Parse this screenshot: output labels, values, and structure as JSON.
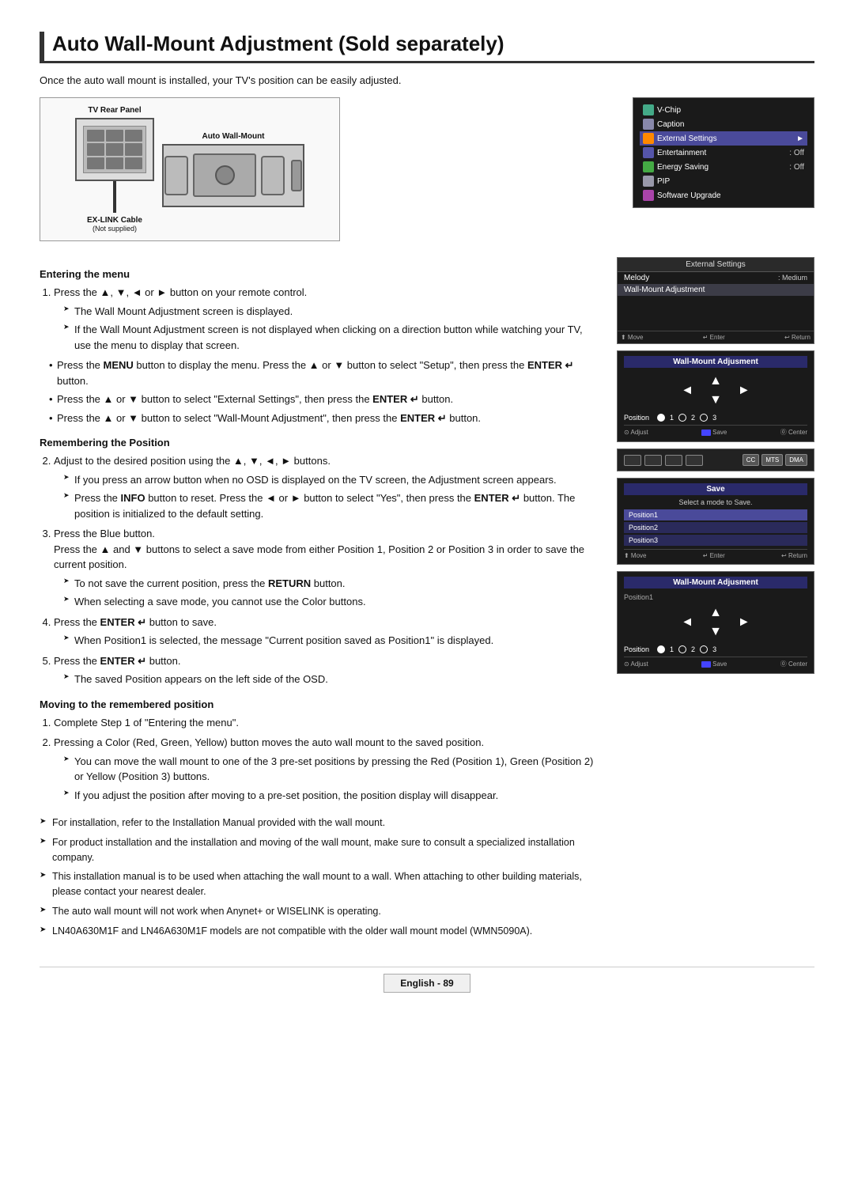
{
  "page": {
    "title": "Auto Wall-Mount Adjustment (Sold separately)",
    "intro": "Once the auto wall mount is installed, your TV's position can be easily adjusted."
  },
  "diagram": {
    "tv_label": "TV Rear Panel",
    "wm_label": "Auto Wall-Mount",
    "cable_label": "EX-LINK Cable",
    "cable_sublabel": "(Not supplied)"
  },
  "osd1": {
    "title": "External Settings",
    "items": [
      {
        "label": "V-Chip",
        "value": ""
      },
      {
        "label": "Caption",
        "value": ""
      },
      {
        "label": "External Settings",
        "value": "",
        "selected": true
      },
      {
        "label": "Entertainment",
        "value": ": Off"
      },
      {
        "label": "Energy Saving",
        "value": ": Off"
      },
      {
        "label": "PIP",
        "value": ""
      },
      {
        "label": "Software Upgrade",
        "value": ""
      }
    ]
  },
  "osd2": {
    "header": "External Settings",
    "melody_label": "Melody",
    "melody_value": ": Medium",
    "wma_label": "Wall-Mount Adjustment",
    "nav_move": "⬆ Move",
    "nav_enter": "↵ Enter",
    "nav_return": "↩ Return"
  },
  "osd3": {
    "title": "Wall-Mount Adjusment",
    "position_label": "Position",
    "pos1": "1",
    "pos2": "2",
    "pos3": "3",
    "adjust_label": "⊙ Adjust",
    "save_label": "Save",
    "center_label": "⓪ Center"
  },
  "osd4": {
    "save_title": "Save",
    "save_prompt": "Select a mode to Save.",
    "options": [
      "Position1",
      "Position2",
      "Position3"
    ],
    "nav_move": "⬆ Move",
    "nav_enter": "↵ Enter",
    "nav_return": "↩ Return"
  },
  "osd5": {
    "title": "Wall-Mount Adjusment",
    "position_label": "Position",
    "pos1_label": "Position1",
    "pos1": "1",
    "pos2": "2",
    "pos3": "3",
    "adjust_label": "⊙ Adjust",
    "save_label": "Save",
    "center_label": "⓪ Center"
  },
  "sections": {
    "entering_menu": {
      "heading": "Entering the menu",
      "step1": {
        "text": "Press the ▲, ▼, ◄ or ► button on your remote control.",
        "sub1": "The Wall Mount Adjustment screen is displayed.",
        "sub2": "If the Wall Mount Adjustment screen is not displayed when clicking on a direction button while watching your TV, use the menu to display that screen."
      },
      "bullet1": "Press the MENU button to display the menu. Press the ▲ or ▼ button to select \"Setup\", then press the ENTER ↵ button.",
      "bullet2": "Press the ▲ or ▼ button to select \"External Settings\", then press the ENTER ↵ button.",
      "bullet3": "Press the ▲ or ▼ button to select \"Wall-Mount Adjustment\", then press the ENTER ↵ button."
    },
    "remembering": {
      "heading": "Remembering the Position",
      "step2": {
        "text": "Adjust to the desired position using the ▲, ▼, ◄, ► buttons.",
        "sub1": "If you press an arrow button when no OSD is displayed on the TV screen, the Adjustment screen appears.",
        "sub2": "Press the INFO button to reset. Press the ◄ or ► button to select \"Yes\", then press the ENTER ↵ button. The position is initialized to the default setting."
      },
      "step3": {
        "text": "Press the Blue button.",
        "sub_text": "Press the ▲ and ▼ buttons to select a save mode from either Position 1, Position 2 or Position 3 in order to save the current position.",
        "sub1": "To not save the current position, press the RETURN button.",
        "sub2": "When selecting a save mode, you cannot use the Color buttons."
      },
      "step4": {
        "text": "Press the ENTER ↵ button to save.",
        "sub1": "When Position1 is selected, the message \"Current position saved as Position1\" is displayed."
      },
      "step5": {
        "text": "Press the ENTER ↵ button.",
        "sub1": "The saved Position appears on the left side of the OSD."
      }
    },
    "moving": {
      "heading": "Moving to the remembered position",
      "step1": "Complete Step 1 of \"Entering the menu\".",
      "step2": {
        "text": "Pressing a Color (Red, Green, Yellow) button moves the auto wall mount to the saved position.",
        "sub1": "You can move the wall mount to one of the 3 pre-set positions by pressing the Red (Position 1), Green (Position 2) or Yellow (Position 3) buttons.",
        "sub2": "If you adjust the position after moving to a pre-set position, the position display will disappear."
      }
    }
  },
  "notes": [
    "For installation, refer to the Installation Manual provided with the wall mount.",
    "For product installation and the installation and moving of the wall mount, make sure to consult a specialized installation company.",
    "This installation manual is to be used when attaching the wall mount to a wall. When attaching to other building materials, please contact your nearest dealer.",
    "The auto wall mount will not work when Anynet+ or WISELINK is operating.",
    "LN40A630M1F and LN46A630M1F models are not compatible with the older wall mount model (WMN5090A)."
  ],
  "footer": {
    "language": "English",
    "page_number": "89"
  }
}
